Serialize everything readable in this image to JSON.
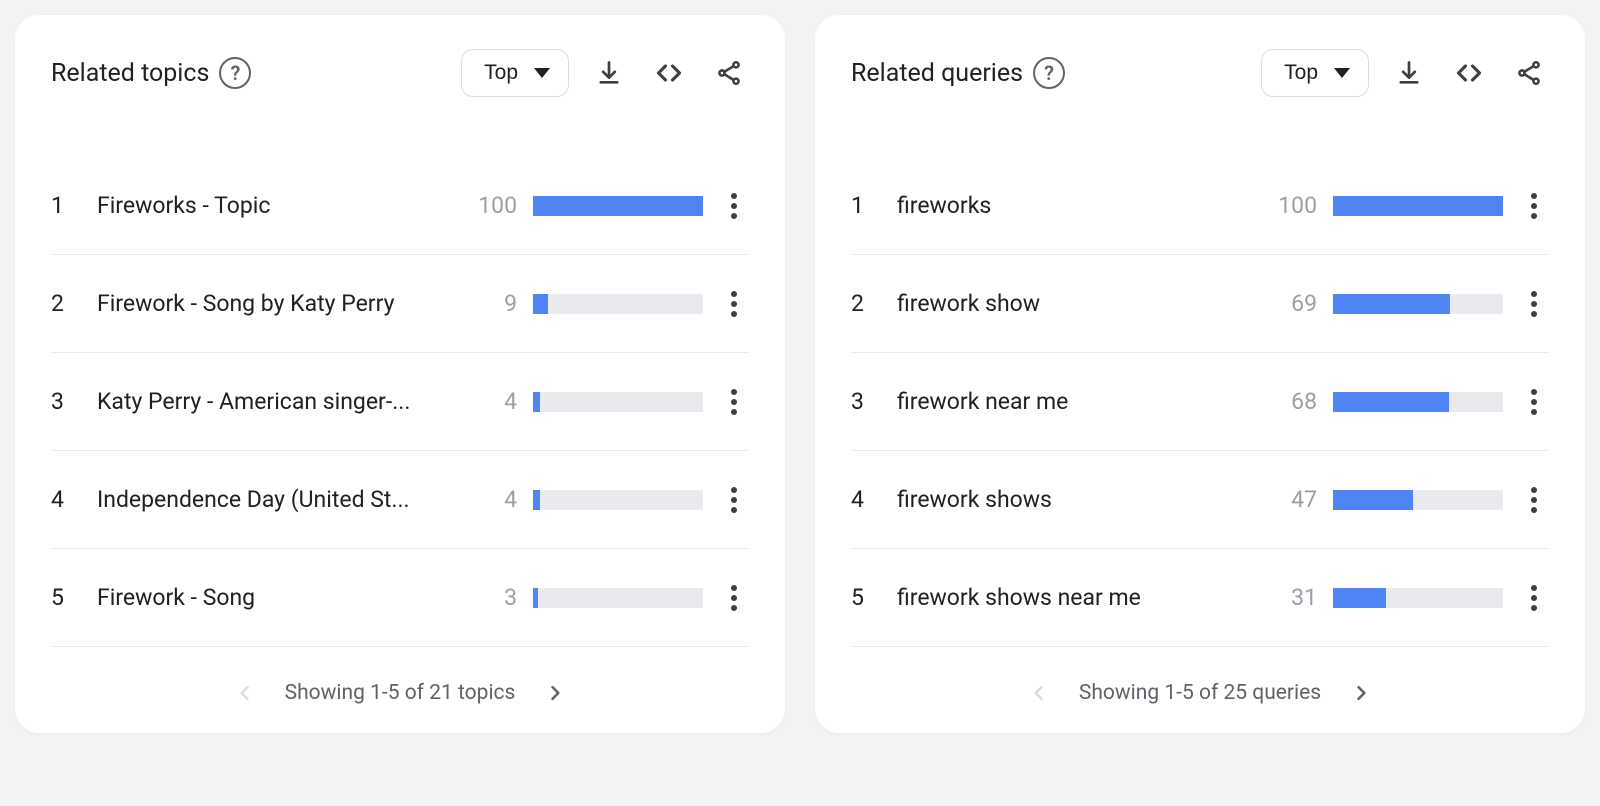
{
  "panels": [
    {
      "title": "Related topics",
      "sort": "Top",
      "pager": "Showing 1-5 of 21 topics",
      "rows": [
        {
          "rank": "1",
          "label": "Fireworks - Topic",
          "value": 100
        },
        {
          "rank": "2",
          "label": "Firework - Song by Katy Perry",
          "value": 9
        },
        {
          "rank": "3",
          "label": "Katy Perry - American singer-...",
          "value": 4
        },
        {
          "rank": "4",
          "label": "Independence Day (United St...",
          "value": 4
        },
        {
          "rank": "5",
          "label": "Firework - Song",
          "value": 3
        }
      ]
    },
    {
      "title": "Related queries",
      "sort": "Top",
      "pager": "Showing 1-5 of 25 queries",
      "rows": [
        {
          "rank": "1",
          "label": "fireworks",
          "value": 100
        },
        {
          "rank": "2",
          "label": "firework show",
          "value": 69
        },
        {
          "rank": "3",
          "label": "firework near me",
          "value": 68
        },
        {
          "rank": "4",
          "label": "firework shows",
          "value": 47
        },
        {
          "rank": "5",
          "label": "firework shows near me",
          "value": 31
        }
      ]
    }
  ]
}
